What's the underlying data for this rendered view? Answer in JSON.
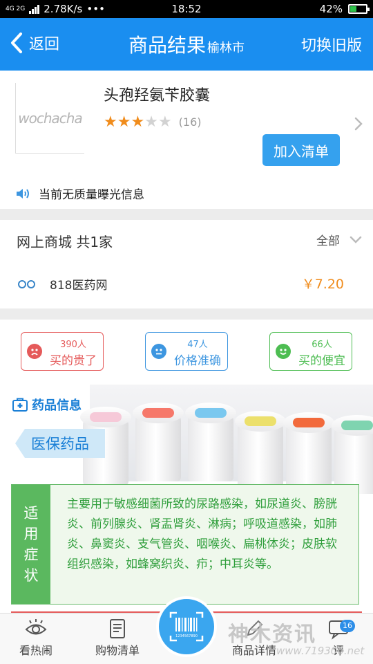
{
  "status_bar": {
    "network": "4G 2G",
    "speed": "2.78K/s",
    "dots": "•••",
    "time": "18:52",
    "battery": "42%",
    "battery_level": 0.42
  },
  "header": {
    "back_label": "返回",
    "title": "商品结果",
    "city": "榆林市",
    "switch_label": "切换旧版"
  },
  "product": {
    "logo_text": "wochacha",
    "name": "头孢羟氨苄胶囊",
    "rating": 3,
    "rating_max": 5,
    "rating_count": "(16)",
    "add_button": "加入清单",
    "notice": "当前无质量曝光信息"
  },
  "mall": {
    "title": "网上商城  共1家",
    "filter_label": "全部",
    "stores": [
      {
        "name": "818医药网",
        "price": "￥7.20"
      }
    ]
  },
  "ratings": [
    {
      "count": "390人",
      "label": "买的贵了",
      "tone": "red",
      "color": "#e55a5a"
    },
    {
      "count": "47人",
      "label": "价格准确",
      "tone": "blue",
      "color": "#3d96e0"
    },
    {
      "count": "66人",
      "label": "买的便宜",
      "tone": "green",
      "color": "#4dbd52"
    }
  ],
  "drug_info": {
    "section_title": "药品信息",
    "tag": "医保药品",
    "indication_label": "适用症状",
    "indication_text": "主要用于敏感细菌所致的尿路感染，如尿道炎、膀胱炎、前列腺炎、肾盂肾炎、淋病；呼吸道感染，如肺炎、鼻窦炎、支气管炎、咽喉炎、扁桃体炎；皮肤软组织感染，如蜂窝织炎、疖；中耳炎等。"
  },
  "bottom_nav": {
    "items": [
      "看热闹",
      "购物清单",
      "商品详情",
      "评"
    ],
    "scan_code": "1234567890",
    "badge": "16"
  },
  "watermark": {
    "text": "神木资讯",
    "url": "www.719300.net"
  },
  "colors": {
    "header_blue": "#1a8ef0",
    "price_orange": "#f08c1c",
    "indication_green": "#5bb85f"
  }
}
